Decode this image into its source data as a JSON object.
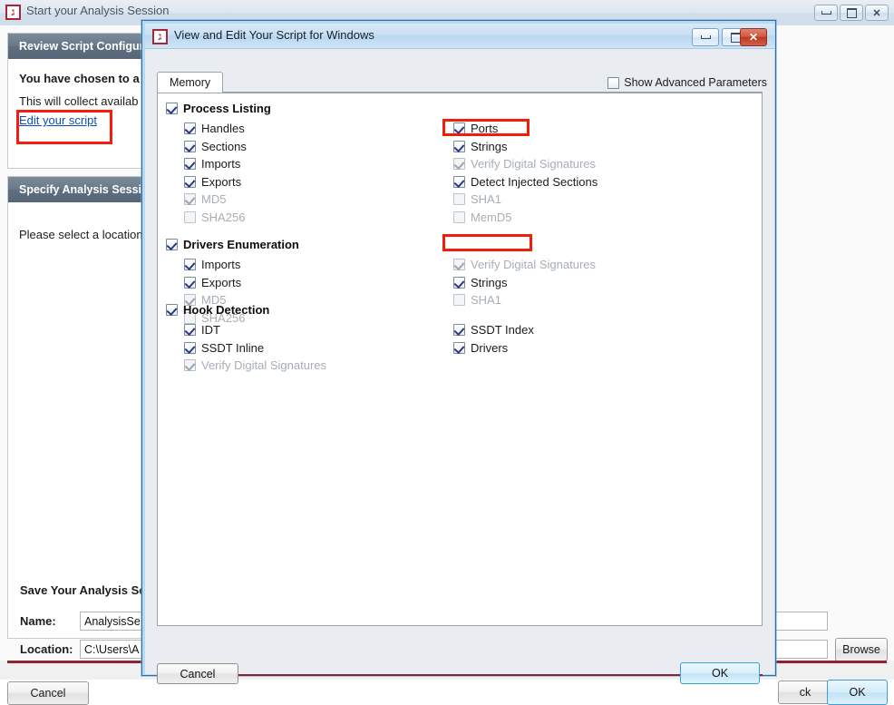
{
  "background_window": {
    "title": "Start your Analysis Session",
    "icon": "app-icon",
    "window_controls": {
      "minimize": "minimize-icon",
      "maximize": "maximize-icon",
      "close": "close-icon"
    },
    "panel1": {
      "header": "Review Script Configuration",
      "bold_line": "You have chosen to a",
      "text_line": "This will collect availab",
      "link": "Edit your script"
    },
    "panel2": {
      "header": "Specify Analysis Session",
      "text_line": "Please select a location"
    },
    "save_section": {
      "heading": "Save Your Analysis Se",
      "name_label": "Name:",
      "name_value": "AnalysisSe",
      "location_label": "Location:",
      "location_value": "C:\\Users\\A",
      "browse_label": "Browse"
    },
    "footer": {
      "cancel_label": "Cancel",
      "back_label": "ck",
      "ok_label": "OK"
    }
  },
  "dialog": {
    "title": "View and Edit Your Script for Windows",
    "icon": "app-icon",
    "window_controls": {
      "minimize": "minimize-icon",
      "maximize": "maximize-icon",
      "close": "close-icon"
    },
    "tab": {
      "label": "Memory"
    },
    "advanced": {
      "label": "Show Advanced Parameters",
      "checked": false
    },
    "groups": [
      {
        "name": "Process Listing",
        "checked": true,
        "left_items": [
          {
            "label": "Handles",
            "checked": true,
            "enabled": true
          },
          {
            "label": "Sections",
            "checked": true,
            "enabled": true
          },
          {
            "label": "Imports",
            "checked": true,
            "enabled": true
          },
          {
            "label": "Exports",
            "checked": true,
            "enabled": true
          },
          {
            "label": "MD5",
            "checked": true,
            "enabled": false
          },
          {
            "label": "SHA256",
            "checked": false,
            "enabled": false
          }
        ],
        "right_items": [
          {
            "label": "Ports",
            "checked": true,
            "enabled": true
          },
          {
            "label": "Strings",
            "checked": true,
            "enabled": true,
            "highlighted": true
          },
          {
            "label": "Verify Digital Signatures",
            "checked": true,
            "enabled": false
          },
          {
            "label": "Detect Injected Sections",
            "checked": true,
            "enabled": true
          },
          {
            "label": "SHA1",
            "checked": false,
            "enabled": false
          },
          {
            "label": "MemD5",
            "checked": false,
            "enabled": false
          }
        ]
      },
      {
        "name": "Drivers Enumeration",
        "checked": true,
        "left_items": [
          {
            "label": "Imports",
            "checked": true,
            "enabled": true
          },
          {
            "label": "Exports",
            "checked": true,
            "enabled": true
          },
          {
            "label": "MD5",
            "checked": true,
            "enabled": false
          },
          {
            "label": "SHA256",
            "checked": false,
            "enabled": false
          }
        ],
        "right_items": [
          {
            "label": "Verify Digital Signatures",
            "checked": true,
            "enabled": false
          },
          {
            "label": "Strings",
            "checked": true,
            "enabled": true,
            "highlighted": true
          },
          {
            "label": "SHA1",
            "checked": false,
            "enabled": false
          }
        ]
      },
      {
        "name": "Hook Detection",
        "checked": true,
        "left_items": [
          {
            "label": "IDT",
            "checked": true,
            "enabled": true
          },
          {
            "label": "SSDT Inline",
            "checked": true,
            "enabled": true
          },
          {
            "label": "Verify Digital Signatures",
            "checked": true,
            "enabled": false
          }
        ],
        "right_items": [
          {
            "label": "SSDT Index",
            "checked": true,
            "enabled": true
          },
          {
            "label": "Drivers",
            "checked": true,
            "enabled": true
          }
        ]
      }
    ],
    "footer": {
      "cancel_label": "Cancel",
      "ok_label": "OK"
    }
  },
  "highlight_color": "#f41d0c",
  "accent_color": "#8d2231"
}
